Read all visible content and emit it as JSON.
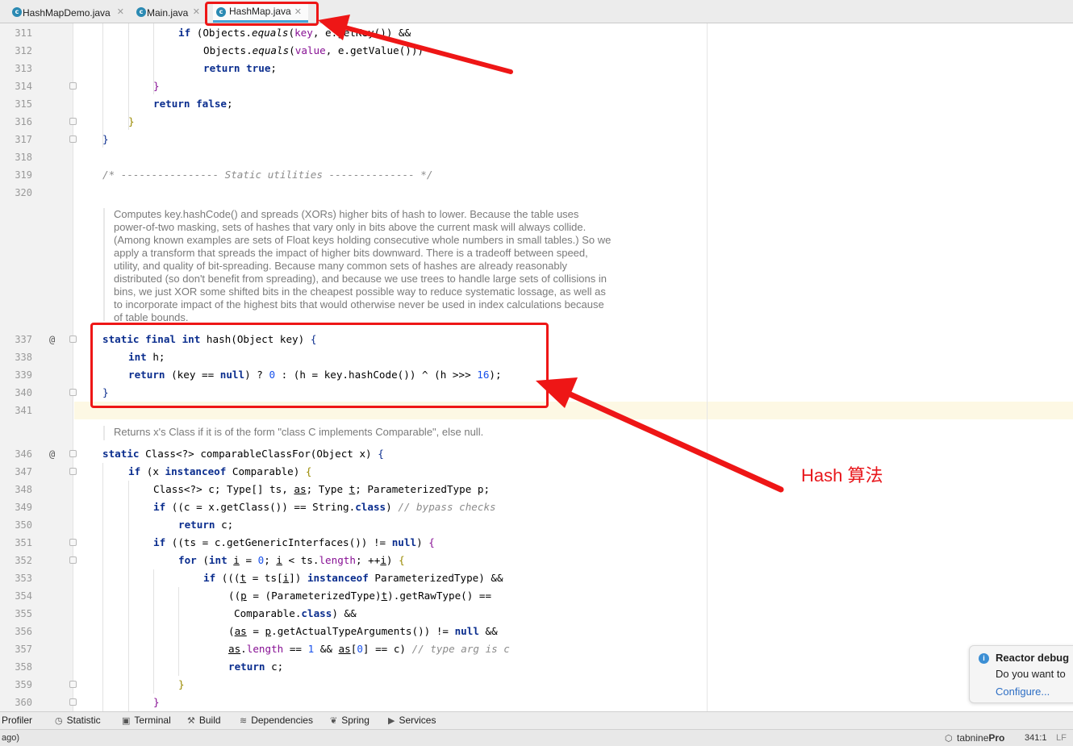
{
  "tabs": [
    {
      "label": "HashMapDemo.java",
      "icon": "java-class-icon",
      "close": "✕"
    },
    {
      "label": "Main.java",
      "icon": "java-class-icon",
      "close": "✕"
    },
    {
      "label": "HashMap.java",
      "icon": "java-class-icon",
      "close": "✕",
      "active": true
    }
  ],
  "gutter": {
    "lines": [
      "311",
      "312",
      "313",
      "314",
      "315",
      "316",
      "317",
      "318",
      "319",
      "320",
      "337",
      "338",
      "339",
      "340",
      "341",
      "346",
      "347",
      "348",
      "349",
      "350",
      "351",
      "352",
      "353",
      "354",
      "355",
      "356",
      "357",
      "358",
      "359",
      "360"
    ],
    "override_marker": "@"
  },
  "doc_comments": {
    "hash": "Computes key.hashCode() and spreads (XORs) higher bits of hash to lower. Because the table uses power-of-two masking, sets of hashes that vary only in bits above the current mask will always collide. (Among known examples are sets of Float keys holding consecutive whole numbers in small tables.) So we apply a transform that spreads the impact of higher bits downward. There is a tradeoff between speed, utility, and quality of bit-spreading. Because many common sets of hashes are already reasonably distributed (so don't benefit from spreading), and because we use trees to handle large sets of collisions in bins, we just XOR some shifted bits in the cheapest possible way to reduce systematic lossage, as well as to incorporate impact of the highest bits that would otherwise never be used in index calculations because of table bounds.",
    "comparable": "Returns x's Class if it is of the form \"class C implements Comparable\", else null."
  },
  "annotation": {
    "label": "Hash 算法",
    "color": "#e8171c"
  },
  "notification": {
    "title": "Reactor debug",
    "body": "Do you want to",
    "link": "Configure..."
  },
  "tool_windows": [
    {
      "label": "Profiler",
      "icon": "profiler-icon"
    },
    {
      "label": "Statistic",
      "icon": "statistic-icon"
    },
    {
      "label": "Terminal",
      "icon": "terminal-icon"
    },
    {
      "label": "Build",
      "icon": "build-icon"
    },
    {
      "label": "Dependencies",
      "icon": "dependencies-icon"
    },
    {
      "label": "Spring",
      "icon": "spring-icon"
    },
    {
      "label": "Services",
      "icon": "services-icon"
    }
  ],
  "status": {
    "left": "ago)",
    "plugin_prefix": "tabnine",
    "plugin_suffix": "Pro",
    "position": "341:1",
    "line_sep": "LF"
  },
  "colors": {
    "keyword": "#0a2d8e",
    "field": "#871094",
    "number": "#1750eb",
    "comment": "#8c8c8c",
    "annotation": "#ee1616"
  }
}
